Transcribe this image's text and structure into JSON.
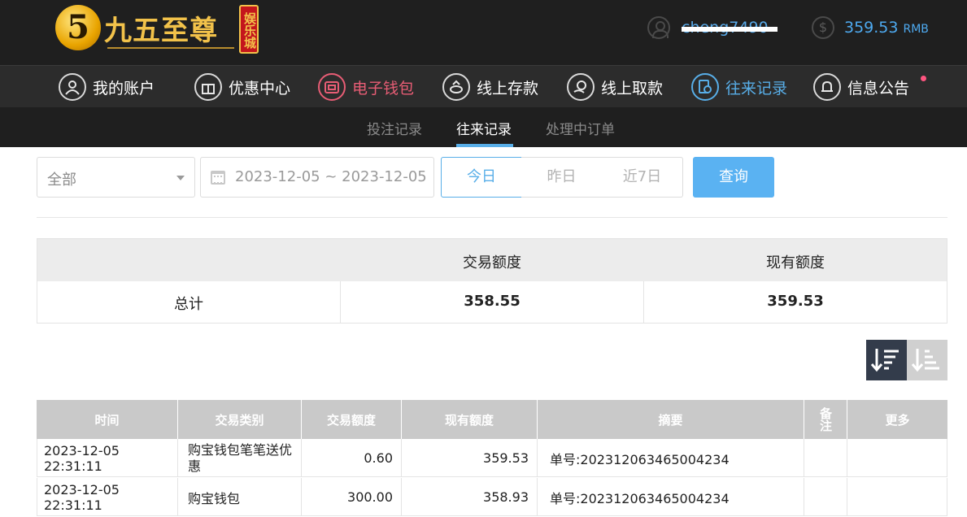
{
  "header": {
    "logo_mark": "5",
    "logo_text": "九五至尊",
    "logo_badge": "娱乐城",
    "username": "cheng7490",
    "balance": "359.53",
    "currency": "RMB"
  },
  "nav": {
    "items": [
      {
        "label": "我的账户",
        "icon": "user-icon"
      },
      {
        "label": "优惠中心",
        "icon": "gift-icon"
      },
      {
        "label": "电子钱包",
        "icon": "wallet-icon"
      },
      {
        "label": "线上存款",
        "icon": "deposit-icon"
      },
      {
        "label": "线上取款",
        "icon": "withdraw-icon"
      },
      {
        "label": "往来记录",
        "icon": "records-icon"
      },
      {
        "label": "信息公告",
        "icon": "bell-icon"
      }
    ],
    "active": "往来记录"
  },
  "subtabs": {
    "items": [
      "投注记录",
      "往来记录",
      "处理中订单"
    ],
    "active": "往来记录"
  },
  "filters": {
    "type_select": "全部",
    "date_range": "2023-12-05 ~ 2023-12-05",
    "today": "今日",
    "yesterday": "昨日",
    "last7": "近7日",
    "query": "查询"
  },
  "summary": {
    "headers": [
      "",
      "交易额度",
      "现有额度"
    ],
    "row_label": "总计",
    "transaction_total": "358.55",
    "current_total": "359.53"
  },
  "table": {
    "headers": [
      "时间",
      "交易类别",
      "交易额度",
      "现有额度",
      "摘要",
      "备注",
      "更多"
    ],
    "rows": [
      {
        "time": "2023-12-05 22:31:11",
        "type": "购宝钱包笔笔送优惠",
        "amount": "0.60",
        "balance": "359.53",
        "summary": "单号:202312063465004234",
        "remark": "",
        "more": ""
      },
      {
        "time": "2023-12-05 22:31:11",
        "type": "购宝钱包",
        "amount": "300.00",
        "balance": "358.93",
        "summary": "单号:202312063465004234",
        "remark": "",
        "more": ""
      }
    ]
  },
  "colors": {
    "accent_blue": "#58aee8",
    "accent_red": "#e85d75",
    "header_bg": "#1f1f1f",
    "nav_bg": "#2c2c2c"
  }
}
